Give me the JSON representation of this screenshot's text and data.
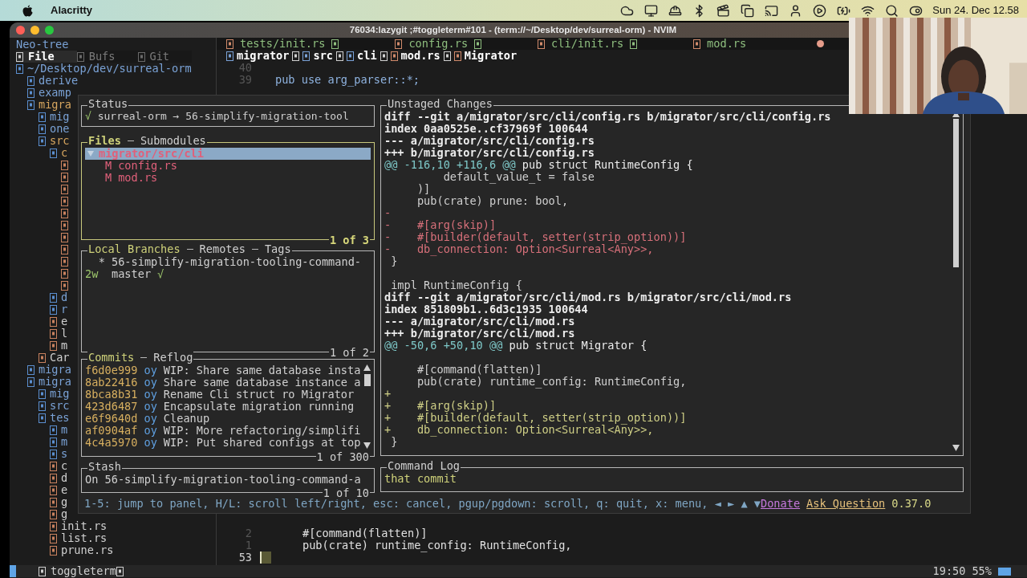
{
  "menubar": {
    "app": "Alacritty",
    "clock": "Sun 24. Dec 12.58"
  },
  "window": {
    "title": "76034:lazygit ;#toggleterm#101 - (term://~/Desktop/dev/surreal-orm) - NVIM"
  },
  "neo_tree": {
    "title": "Neo-tree",
    "tabs": [
      {
        "label": "File",
        "selected": true
      },
      {
        "label": "Bufs",
        "selected": false
      },
      {
        "label": "Git",
        "selected": false
      }
    ],
    "root": {
      "label": "~/Desktop/dev/surreal-orm",
      "kind": "folder",
      "modified": false,
      "children": [
        {
          "label": "derive",
          "kind": "folder",
          "modified": false
        },
        {
          "label": "examp",
          "kind": "folder",
          "modified": false
        },
        {
          "label": "migra",
          "kind": "folder",
          "modified": true,
          "children": [
            {
              "label": "mig",
              "kind": "folder",
              "modified": false
            },
            {
              "label": "one",
              "kind": "folder",
              "modified": false
            },
            {
              "label": "src",
              "kind": "folder",
              "modified": true,
              "children": [
                {
                  "label": "c",
                  "kind": "folder",
                  "modified": true,
                  "children": [
                    {
                      "kind": "file"
                    },
                    {
                      "kind": "file"
                    },
                    {
                      "kind": "file"
                    },
                    {
                      "kind": "file"
                    },
                    {
                      "kind": "file"
                    },
                    {
                      "kind": "file"
                    },
                    {
                      "kind": "file"
                    },
                    {
                      "kind": "file"
                    },
                    {
                      "kind": "file"
                    },
                    {
                      "kind": "file"
                    },
                    {
                      "kind": "file"
                    }
                  ]
                },
                {
                  "label": "d",
                  "kind": "folder",
                  "modified": false
                },
                {
                  "label": "r",
                  "kind": "folder",
                  "modified": false
                },
                {
                  "label": "e",
                  "kind": "file",
                  "modified": false
                },
                {
                  "label": "l",
                  "kind": "file",
                  "modified": false
                },
                {
                  "label": "m",
                  "kind": "file",
                  "modified": false
                }
              ]
            },
            {
              "label": "Car",
              "kind": "file",
              "modified": false
            }
          ]
        },
        {
          "label": "migra",
          "kind": "folder",
          "modified": false
        },
        {
          "label": "migra",
          "kind": "folder",
          "modified": false,
          "children": [
            {
              "label": "mig",
              "kind": "folder",
              "modified": false
            },
            {
              "label": "src",
              "kind": "folder",
              "modified": false
            },
            {
              "label": "tes",
              "kind": "folder",
              "modified": false,
              "children": [
                {
                  "label": "m",
                  "kind": "folder",
                  "modified": false
                },
                {
                  "label": "m",
                  "kind": "folder",
                  "modified": false
                },
                {
                  "label": "s",
                  "kind": "folder",
                  "modified": false
                },
                {
                  "label": "c",
                  "kind": "file",
                  "modified": false
                },
                {
                  "label": "d",
                  "kind": "file",
                  "modified": false
                },
                {
                  "label": "e",
                  "kind": "file",
                  "modified": false
                },
                {
                  "label": "g",
                  "kind": "file",
                  "modified": false
                },
                {
                  "label": "g",
                  "kind": "file",
                  "modified": false
                },
                {
                  "label": "init.rs",
                  "kind": "file",
                  "modified": false
                },
                {
                  "label": "list.rs",
                  "kind": "file",
                  "modified": false
                },
                {
                  "label": "prune.rs",
                  "kind": "file",
                  "modified": false
                }
              ]
            }
          ]
        }
      ]
    }
  },
  "editor": {
    "tabs": [
      {
        "label": "tests/init.rs",
        "modified": false
      },
      {
        "label": "config.rs",
        "modified": false
      },
      {
        "label": "cli/init.rs",
        "modified": false
      },
      {
        "label": "mod.rs",
        "modified": true
      }
    ],
    "breadcrumb": [
      "migrator",
      "src",
      "cli",
      "mod.rs",
      "Migrator"
    ],
    "top_lines": [
      {
        "number": "40"
      },
      {
        "number": "39",
        "code": "pub use arg_parser::*;"
      }
    ],
    "bottom_lines": [
      {
        "number": "2",
        "code": "#[command(flatten)]"
      },
      {
        "number": "1",
        "code": "pub(crate) runtime_config: RuntimeConfig,"
      },
      {
        "number": "53",
        "cursor": true
      }
    ]
  },
  "lazygit": {
    "status": {
      "tabs": [
        {
          "label": "Status",
          "selected": false
        }
      ],
      "mark": "√",
      "text": "surreal-orm → 56-simplify-migration-tool"
    },
    "files": {
      "tabs": [
        {
          "label": "Files",
          "selected": true
        },
        {
          "label": "Submodules",
          "selected": false
        }
      ],
      "focused": true,
      "count": "1 of 3",
      "tree": [
        {
          "label": "migrator/src/cli",
          "expanded": true,
          "selected": true,
          "children": [
            {
              "status": "M",
              "label": "config.rs"
            },
            {
              "status": "M",
              "label": "mod.rs"
            }
          ]
        }
      ]
    },
    "branches": {
      "tabs": [
        {
          "label": "Local Branches",
          "selected": true
        },
        {
          "label": "Remotes",
          "selected": false
        },
        {
          "label": "Tags",
          "selected": false
        }
      ],
      "count": "1 of 2",
      "items": [
        {
          "prefix": "*",
          "current": true,
          "name": "56-simplify-migration-tooling-command-"
        },
        {
          "prefix": "2w",
          "current": false,
          "name": "master",
          "mark": "√"
        }
      ]
    },
    "commits": {
      "tabs": [
        {
          "label": "Commits",
          "selected": true
        },
        {
          "label": "Reflog",
          "selected": false
        }
      ],
      "count": "1 of 300",
      "items": [
        {
          "hash": "f6d0e999",
          "author": "oy",
          "message": "WIP: Share same database insta"
        },
        {
          "hash": "8ab22416",
          "author": "oy",
          "message": "Share same database instance a"
        },
        {
          "hash": "8bca8b31",
          "author": "oy",
          "message": "Rename Cli struct ro Migrator"
        },
        {
          "hash": "423d6487",
          "author": "oy",
          "message": "Encapsulate migration running"
        },
        {
          "hash": "e6f9640d",
          "author": "oy",
          "message": "Cleanup"
        },
        {
          "hash": "af0904af",
          "author": "oy",
          "message": "WIP: More refactoring/simplifi"
        },
        {
          "hash": "4c4a5970",
          "author": "oy",
          "message": "WIP: Put shared configs at top"
        }
      ]
    },
    "stash": {
      "tabs": [
        {
          "label": "Stash",
          "selected": false
        }
      ],
      "count": "1 of 10",
      "items": [
        "On 56-simplify-migration-tooling-command-a"
      ]
    },
    "diff": {
      "tabs": [
        {
          "label": "Unstaged Changes",
          "selected": false
        }
      ],
      "lines": [
        {
          "kind": "header",
          "text": "diff --git a/migrator/src/cli/config.rs b/migrator/src/cli/config.rs"
        },
        {
          "kind": "header",
          "text": "index 0aa0525e..cf37969f 100644"
        },
        {
          "kind": "header",
          "text": "--- a/migrator/src/cli/config.rs"
        },
        {
          "kind": "header",
          "text": "+++ b/migrator/src/cli/config.rs"
        },
        {
          "kind": "hunk",
          "range": "@@ -116,10 +116,6 @@",
          "text": " pub struct RuntimeConfig {"
        },
        {
          "kind": "context",
          "text": "         default_value_t = false"
        },
        {
          "kind": "context",
          "text": "     )]"
        },
        {
          "kind": "context",
          "text": "     pub(crate) prune: bool,"
        },
        {
          "kind": "removed",
          "text": "-"
        },
        {
          "kind": "removed",
          "text": "-    #[arg(skip)]"
        },
        {
          "kind": "removed",
          "text": "-    #[builder(default, setter(strip_option))]"
        },
        {
          "kind": "removed",
          "text": "-    db_connection: Option<Surreal<Any>>,"
        },
        {
          "kind": "context",
          "text": " }"
        },
        {
          "kind": "blank"
        },
        {
          "kind": "context",
          "text": " impl RuntimeConfig {"
        },
        {
          "kind": "header",
          "text": "diff --git a/migrator/src/cli/mod.rs b/migrator/src/cli/mod.rs"
        },
        {
          "kind": "header",
          "text": "index 851809b1..6d3c1935 100644"
        },
        {
          "kind": "header",
          "text": "--- a/migrator/src/cli/mod.rs"
        },
        {
          "kind": "header",
          "text": "+++ b/migrator/src/cli/mod.rs"
        },
        {
          "kind": "hunk",
          "range": "@@ -50,6 +50,10 @@",
          "text": " pub struct Migrator {"
        },
        {
          "kind": "blank"
        },
        {
          "kind": "context",
          "text": "     #[command(flatten)]"
        },
        {
          "kind": "context",
          "text": "     pub(crate) runtime_config: RuntimeConfig,"
        },
        {
          "kind": "added",
          "text": "+"
        },
        {
          "kind": "added",
          "text": "+    #[arg(skip)]"
        },
        {
          "kind": "added",
          "text": "+    #[builder(default, setter(strip_option))]"
        },
        {
          "kind": "added",
          "text": "+    db_connection: Option<Surreal<Any>>,"
        },
        {
          "kind": "context",
          "text": " }"
        }
      ]
    },
    "command_log": {
      "tabs": [
        {
          "label": "Command Log",
          "selected": false
        }
      ],
      "lines": [
        "that commit"
      ]
    },
    "footer": {
      "keys": "1-5: jump to panel, H/L: scroll left/right, esc: cancel, pgup/pgdown: scroll, q: quit, x: menu, ◄ ► ▲ ▼",
      "donate": "Donate",
      "ask": "Ask Question",
      "version": "0.37.0"
    }
  },
  "status_line": {
    "label": "toggleterm",
    "position": "19:50",
    "percent": "55%"
  }
}
